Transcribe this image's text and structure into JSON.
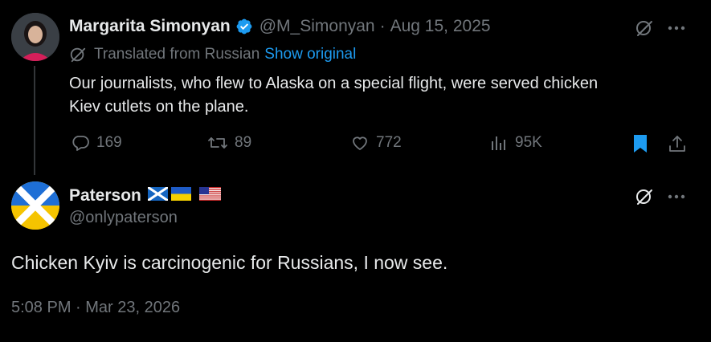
{
  "tweet1": {
    "name": "Margarita Simonyan",
    "handle": "@M_Simonyan",
    "separator": "·",
    "date": "Aug 15, 2025",
    "translated_text": "Translated from Russian",
    "show_original": "Show original",
    "text_line1": "Our journalists, who flew to Alaska on a special flight, were served chicken",
    "text_line2": "Kiev cutlets on the plane.",
    "replies": "169",
    "reposts": "89",
    "likes": "772",
    "views": "95K"
  },
  "tweet2": {
    "name": "Paterson",
    "handle": "@onlypaterson",
    "text": "Chicken Kyiv is carcinogenic for Russians, I now see.",
    "timestamp": "5:08 PM · Mar 23, 2026"
  },
  "colors": {
    "background": "#000000",
    "text": "#e7e9ea",
    "muted": "#71767b",
    "link": "#1d9bf0",
    "verified": "#1d9bf0"
  },
  "icons": [
    "verified-badge-icon",
    "grok-icon",
    "more-icon",
    "translate-icon",
    "reply-icon",
    "repost-icon",
    "like-icon",
    "views-icon",
    "bookmark-icon",
    "share-icon",
    "scotland-flag-icon",
    "ukraine-flag-icon",
    "usa-flag-icon"
  ]
}
